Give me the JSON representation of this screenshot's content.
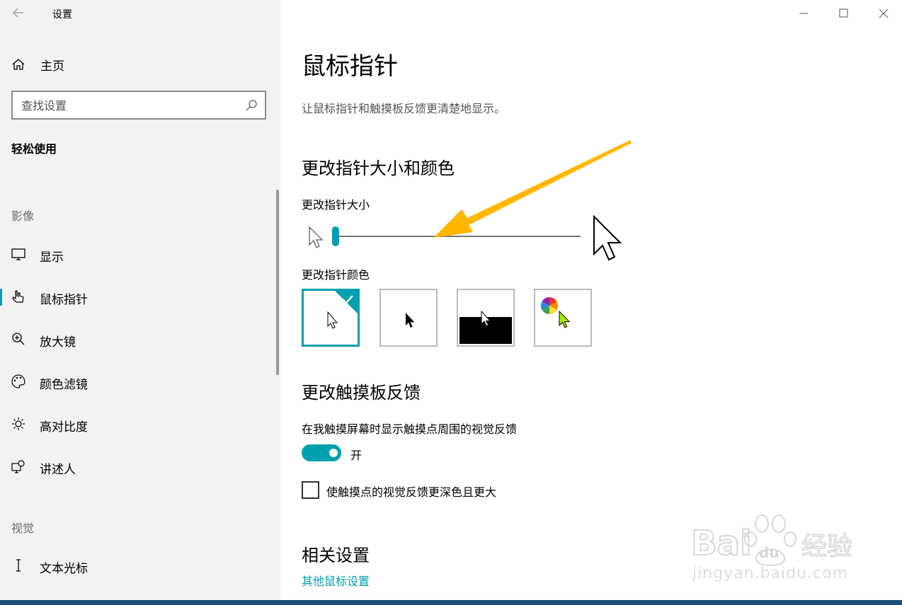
{
  "window": {
    "title": "设置"
  },
  "sidebar": {
    "home_label": "主页",
    "search_placeholder": "查找设置",
    "section_title": "轻松使用",
    "groups": [
      {
        "label": "影像",
        "items": [
          {
            "label": "显示",
            "icon": "monitor-icon"
          },
          {
            "label": "鼠标指针",
            "icon": "mouse-pointer-icon",
            "selected": true
          },
          {
            "label": "放大镜",
            "icon": "magnifier-icon"
          },
          {
            "label": "颜色滤镜",
            "icon": "palette-icon"
          },
          {
            "label": "高对比度",
            "icon": "brightness-icon"
          },
          {
            "label": "讲述人",
            "icon": "narrator-icon"
          }
        ]
      },
      {
        "label": "视觉",
        "items": [
          {
            "label": "文本光标",
            "icon": "text-cursor-icon"
          }
        ]
      }
    ]
  },
  "main": {
    "title": "鼠标指针",
    "description": "让鼠标指针和触摸板反馈更清楚地显示。",
    "size_color_section": {
      "heading": "更改指针大小和颜色",
      "size_label": "更改指针大小",
      "size_value": 1,
      "color_label": "更改指针颜色",
      "color_options": [
        "white",
        "black",
        "inverted",
        "custom"
      ],
      "selected_color": "white"
    },
    "touch_section": {
      "heading": "更改触摸板反馈",
      "toggle_label": "在我触摸屏幕时显示触摸点周围的视觉反馈",
      "toggle_state": "开",
      "toggle_on": true,
      "checkbox_label": "使触摸点的视觉反馈更深色且更大",
      "checkbox_checked": false
    },
    "related_section": {
      "heading": "相关设置",
      "link": "其他鼠标设置"
    }
  },
  "colors": {
    "accent": "#00a0ad",
    "sidebar_bg": "#f2f2f2",
    "annotation": "#ffb800"
  },
  "watermark": {
    "text": "jingyan.baidu.com"
  }
}
